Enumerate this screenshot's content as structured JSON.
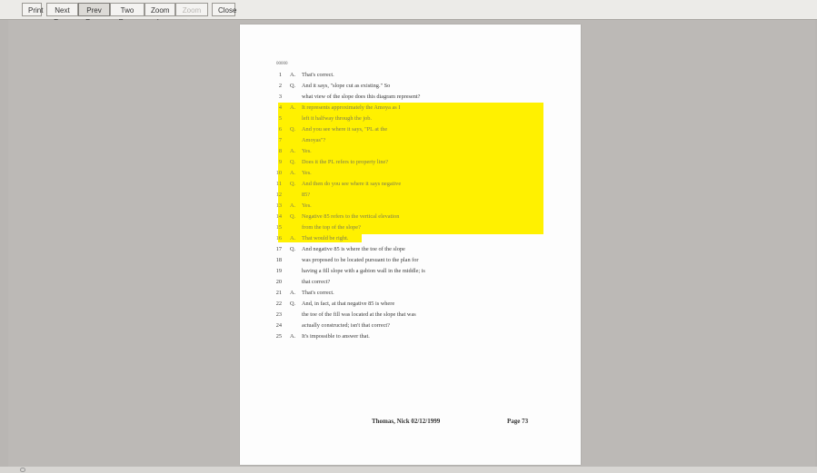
{
  "toolbar": {
    "buttons": [
      {
        "label": "Print"
      },
      {
        "label": "Next Page"
      },
      {
        "label": "Prev Page"
      },
      {
        "label": "Two Page"
      },
      {
        "label": "Zoom In"
      },
      {
        "label": "Zoom Out"
      },
      {
        "label": "Close"
      }
    ]
  },
  "page": {
    "header_mark": "00000",
    "lines": [
      {
        "num": "1",
        "marker": "A.",
        "text": "That's correct."
      },
      {
        "num": "2",
        "marker": "Q.",
        "text": "And it says, \"slope cut as existing.\" So"
      },
      {
        "num": "3",
        "marker": "",
        "text": "what view of the slope does this diagram represent?"
      },
      {
        "num": "4",
        "marker": "A.",
        "text": "It represents approximately the Amoya as I"
      },
      {
        "num": "5",
        "marker": "",
        "text": "left it halfway through the job."
      },
      {
        "num": "6",
        "marker": "Q.",
        "text": "And you see where it says, \"PL at the"
      },
      {
        "num": "7",
        "marker": "",
        "text": "Amoyas\"?"
      },
      {
        "num": "8",
        "marker": "A.",
        "text": "Yes."
      },
      {
        "num": "9",
        "marker": "Q.",
        "text": "Does it the PL refers to property line?"
      },
      {
        "num": "10",
        "marker": "A.",
        "text": "Yes."
      },
      {
        "num": "11",
        "marker": "Q.",
        "text": "And then do you see where it says negative"
      },
      {
        "num": "12",
        "marker": "",
        "text": "85?"
      },
      {
        "num": "13",
        "marker": "A.",
        "text": "Yes."
      },
      {
        "num": "14",
        "marker": "Q.",
        "text": "Negative 85 refers to the vertical elevation"
      },
      {
        "num": "15",
        "marker": "",
        "text": "from the top of the slope?"
      },
      {
        "num": "16",
        "marker": "A.",
        "text": "That would be right."
      },
      {
        "num": "17",
        "marker": "Q.",
        "text": "And negative 85 is where the toe of the slope"
      },
      {
        "num": "18",
        "marker": "",
        "text": "was proposed to be located pursuant to the plan for"
      },
      {
        "num": "19",
        "marker": "",
        "text": "having a fill slope with a gabion wall in the middle; is"
      },
      {
        "num": "20",
        "marker": "",
        "text": "that correct?"
      },
      {
        "num": "21",
        "marker": "A.",
        "text": "That's correct."
      },
      {
        "num": "22",
        "marker": "Q.",
        "text": "And, in fact, at that negative 85 is where"
      },
      {
        "num": "23",
        "marker": "",
        "text": "the toe of the fill was located at the slope that was"
      },
      {
        "num": "24",
        "marker": "",
        "text": "actually constructed; isn't that correct?"
      },
      {
        "num": "25",
        "marker": "A.",
        "text": "It's impossible to answer that."
      }
    ],
    "footer_name": "Thomas, Nick 02/12/1999",
    "footer_page": "Page 73"
  },
  "colors": {
    "highlight": "#fff100",
    "workspace": "#bcb9b6",
    "page": "#fdfdfd"
  }
}
